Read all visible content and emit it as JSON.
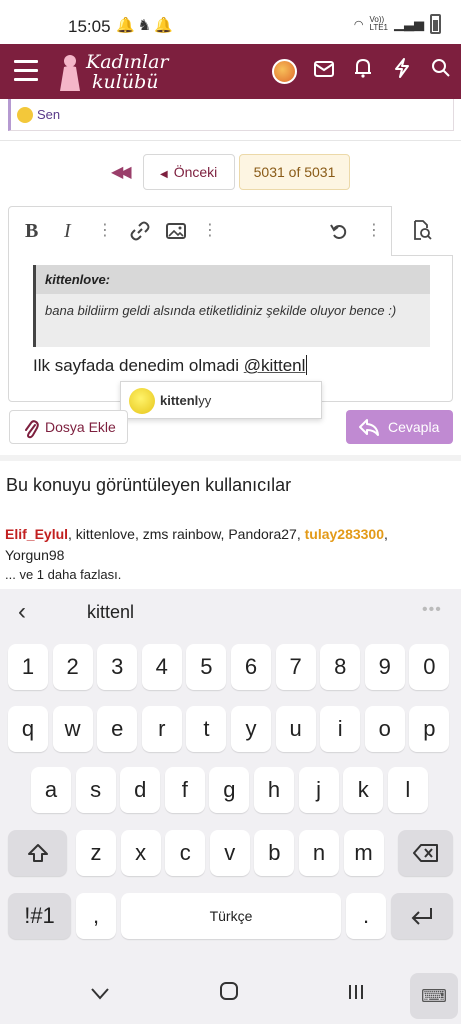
{
  "status": {
    "time": "15:05",
    "network": "Vo))\nLTE1"
  },
  "header": {
    "logo_line1": "Kadınlar",
    "logo_line2": "kulübü"
  },
  "reactions": {
    "label": "Sen"
  },
  "pager": {
    "prev_label": "Önceki",
    "current": "5031 of 5031"
  },
  "editor": {
    "quote_author": "kittenlove:",
    "quote_text": "bana bildiirm geldi alsında etiketlidiniz şekilde oluyor bence :)",
    "message_text": "Ilk sayfada denedim olmadi ",
    "mention_text": "@kittenl"
  },
  "suggestion": {
    "match": "kittenl",
    "rest": "yy"
  },
  "buttons": {
    "attach": "Dosya Ekle",
    "reply": "Cevapla"
  },
  "viewers": {
    "title": "Bu konuyu görüntüleyen kullanıcılar",
    "user1": "Elif_Eylul",
    "middle": ", kittenlove, zms rainbow, Pandora27, ",
    "user_highlight": "tulay283300",
    "after": ",",
    "user_last": "Yorgun98",
    "more": "... ve 1 daha fazlası."
  },
  "keyboard": {
    "suggestion_word": "kittenl",
    "row_numbers": [
      "1",
      "2",
      "3",
      "4",
      "5",
      "6",
      "7",
      "8",
      "9",
      "0"
    ],
    "row1": [
      "q",
      "w",
      "e",
      "r",
      "t",
      "y",
      "u",
      "i",
      "o",
      "p"
    ],
    "row2": [
      "a",
      "s",
      "d",
      "f",
      "g",
      "h",
      "j",
      "k",
      "l"
    ],
    "row3": [
      "z",
      "x",
      "c",
      "v",
      "b",
      "n",
      "m"
    ],
    "symbols": "!#1",
    "comma": ",",
    "space": "Türkçe",
    "period": "."
  },
  "colors": {
    "brand": "#7d1f3e",
    "reply": "#c08ad2",
    "accent_red": "#c22020",
    "accent_orange": "#e39a18"
  }
}
